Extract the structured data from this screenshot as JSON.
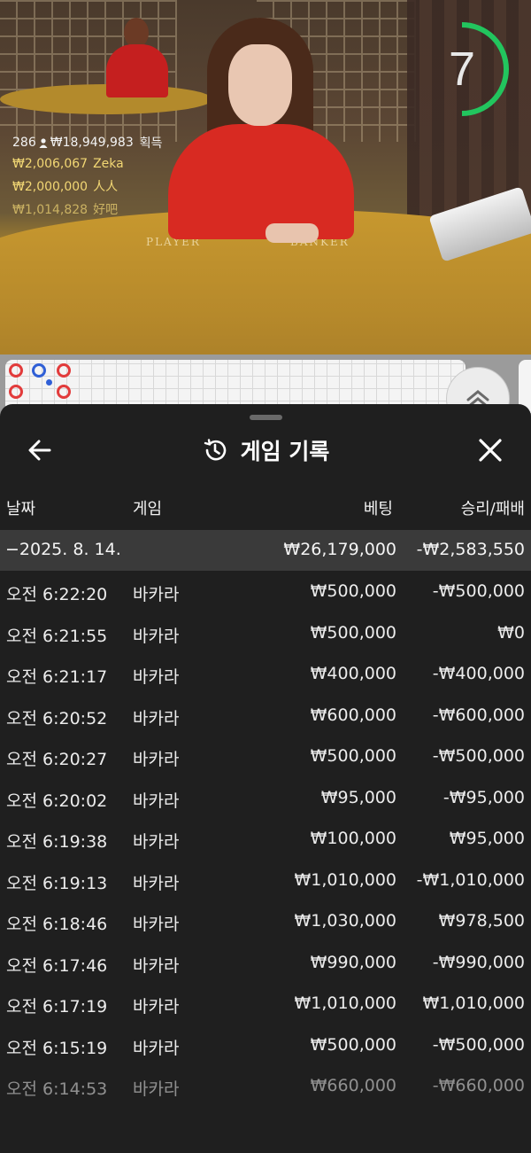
{
  "video": {
    "table_labels": {
      "player": "PLAYER",
      "banker": "BANKER"
    },
    "countdown": "7",
    "winners": {
      "count": "286",
      "total": "₩18,949,983",
      "suffix": "획득",
      "list": [
        {
          "amount": "₩2,006,067",
          "name": "Zeka"
        },
        {
          "amount": "₩2,000,000",
          "name": "人人"
        },
        {
          "amount": "₩1,014,828",
          "name": "好吧"
        }
      ]
    }
  },
  "colors": {
    "timer_ring": "#22c55e",
    "bead_red": "#e23b3b",
    "bead_blue": "#2f5fd6"
  },
  "history": {
    "title": "게임 기록",
    "columns": {
      "date": "날짜",
      "game": "게임",
      "bet": "베팅",
      "result": "승리/패배"
    },
    "date_group": {
      "label": "−2025. 8. 14.",
      "bet_total": "₩26,179,000",
      "result_total": "-₩2,583,550"
    },
    "rows": [
      {
        "time": "오전 6:22:20",
        "game": "바카라",
        "bet": "₩500,000",
        "result": "-₩500,000"
      },
      {
        "time": "오전 6:21:55",
        "game": "바카라",
        "bet": "₩500,000",
        "result": "₩0"
      },
      {
        "time": "오전 6:21:17",
        "game": "바카라",
        "bet": "₩400,000",
        "result": "-₩400,000"
      },
      {
        "time": "오전 6:20:52",
        "game": "바카라",
        "bet": "₩600,000",
        "result": "-₩600,000"
      },
      {
        "time": "오전 6:20:27",
        "game": "바카라",
        "bet": "₩500,000",
        "result": "-₩500,000"
      },
      {
        "time": "오전 6:20:02",
        "game": "바카라",
        "bet": "₩95,000",
        "result": "-₩95,000"
      },
      {
        "time": "오전 6:19:38",
        "game": "바카라",
        "bet": "₩100,000",
        "result": "₩95,000"
      },
      {
        "time": "오전 6:19:13",
        "game": "바카라",
        "bet": "₩1,010,000",
        "result": "-₩1,010,000"
      },
      {
        "time": "오전 6:18:46",
        "game": "바카라",
        "bet": "₩1,030,000",
        "result": "₩978,500"
      },
      {
        "time": "오전 6:17:46",
        "game": "바카라",
        "bet": "₩990,000",
        "result": "-₩990,000"
      },
      {
        "time": "오전 6:17:19",
        "game": "바카라",
        "bet": "₩1,010,000",
        "result": "₩1,010,000"
      },
      {
        "time": "오전 6:15:19",
        "game": "바카라",
        "bet": "₩500,000",
        "result": "-₩500,000"
      },
      {
        "time": "오전 6:14:53",
        "game": "바카라",
        "bet": "₩660,000",
        "result": "-₩660,000"
      }
    ]
  }
}
